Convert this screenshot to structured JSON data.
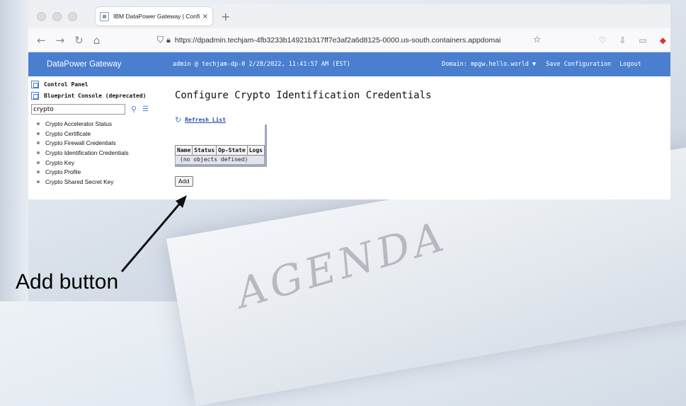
{
  "browser": {
    "tab_title": "IBM DataPower Gateway | Confi",
    "tab_close": "×",
    "new_tab": "+",
    "url": "https://dpadmin.techjam-4fb3233b14921b317ff7e3af2a6d8125-0000.us-south.containers.appdomai"
  },
  "header": {
    "brand": "DataPower Gateway",
    "user_info": "admin @ techjam-dp-0 2/28/2022, 11:41:57 AM (EST)",
    "domain": "Domain: mpgw.hello.world ▼",
    "save": "Save Configuration",
    "logout": "Logout"
  },
  "sidebar": {
    "control_panel": "Control Panel",
    "blueprint": "Blueprint Console (deprecated)",
    "search_value": "crypto",
    "items": [
      "Crypto Accelerator Status",
      "Crypto Certificate",
      "Crypto Firewall Credentials",
      "Crypto Identification Credentials",
      "Crypto Key",
      "Crypto Profile",
      "Crypto Shared Secret Key"
    ]
  },
  "main": {
    "title": "Configure Crypto Identification Credentials",
    "refresh": "Refresh List",
    "columns": [
      "Name",
      "Status",
      "Op-State",
      "Logs"
    ],
    "empty_row": "(no objects defined)",
    "add_button": "Add"
  },
  "annotation": {
    "label": "Add button"
  },
  "background": {
    "agenda": "AGENDA"
  },
  "colors": {
    "header_bg": "#4a7fcf",
    "link": "#2b4fa8"
  }
}
